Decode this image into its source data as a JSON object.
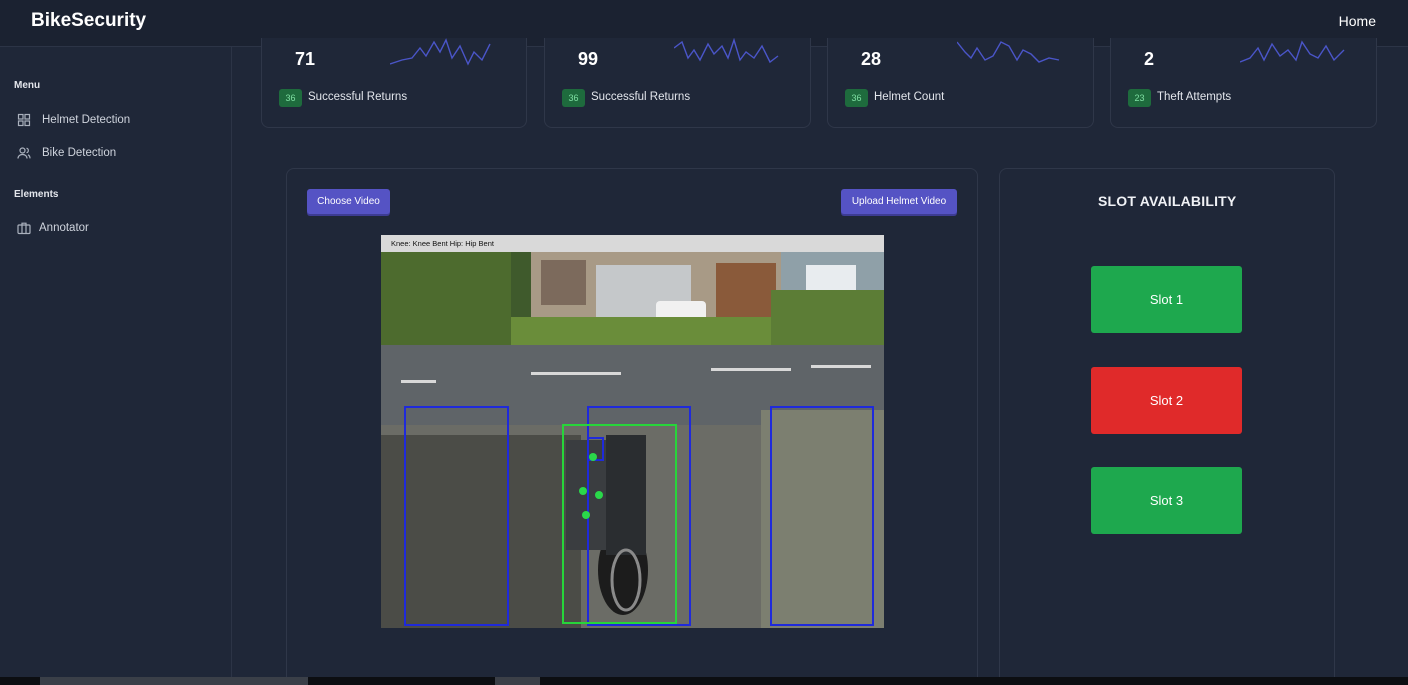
{
  "header": {
    "brand": "BikeSecurity",
    "home_label": "Home"
  },
  "sidebar": {
    "menu_heading": "Menu",
    "items": [
      {
        "label": "Helmet Detection",
        "icon": "grid-icon"
      },
      {
        "label": "Bike Detection",
        "icon": "users-icon"
      }
    ],
    "elements_heading": "Elements",
    "elements": [
      {
        "label": "Annotator",
        "icon": "briefcase-icon"
      }
    ]
  },
  "stats": [
    {
      "value": "71",
      "badge": "36",
      "label": "Successful Returns"
    },
    {
      "value": "99",
      "badge": "36",
      "label": "Successful Returns"
    },
    {
      "value": "28",
      "badge": "36",
      "label": "Helmet Count"
    },
    {
      "value": "2",
      "badge": "23",
      "label": "Theft Attempts"
    }
  ],
  "video_panel": {
    "choose_label": "Choose Video",
    "upload_label": "Upload Helmet Video",
    "caption": "Knee: Knee Bent  Hip: Hip Bent"
  },
  "slots": {
    "title": "SLOT AVAILABILITY",
    "items": [
      {
        "label": "Slot 1",
        "status": "available",
        "color": "#1ea84e"
      },
      {
        "label": "Slot 2",
        "status": "occupied",
        "color": "#e02a2a"
      },
      {
        "label": "Slot 3",
        "status": "available",
        "color": "#1ea84e"
      }
    ]
  },
  "colors": {
    "accent": "#5553c4",
    "badge_bg": "#1e6b3d",
    "sparkline": "#4a55c8"
  }
}
